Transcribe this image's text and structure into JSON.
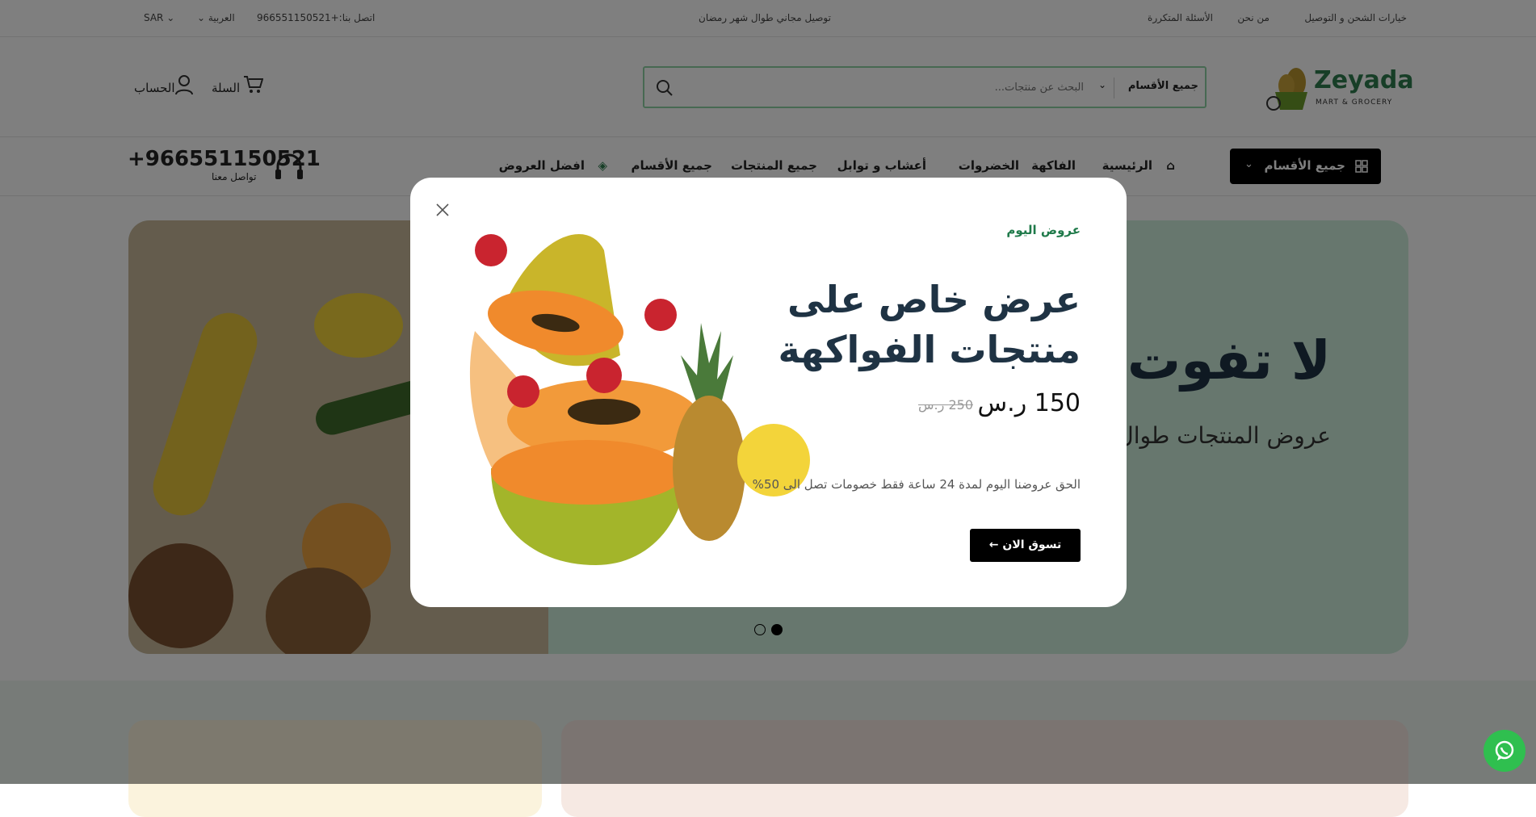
{
  "topbar": {
    "links": [
      "خيارات الشحن و التوصيل",
      "من نحن",
      "الأسئلة المتكررة"
    ],
    "promo": "توصيل مجاني طوال شهر رمضان",
    "contact": "اتصل بنا:+966551150521",
    "language": "العربية",
    "currency": "SAR"
  },
  "header": {
    "logo_name": "Zeyada",
    "logo_sub": "MART & GROCERY",
    "search_category": "جميع الأقسام",
    "search_placeholder": "البحث عن منتجات...",
    "cart_label": "السلة",
    "account_label": "الحساب"
  },
  "nav": {
    "categories_button": "جميع الأقسام",
    "items": [
      "الرئيسية",
      "الفاكهة",
      "الخضروات",
      "أعشاب و توابل",
      "جميع المنتجات",
      "جميع الأقسام",
      "افضل العروض"
    ],
    "phone": "+966551150521",
    "phone_label": "تواصل معنا"
  },
  "hero": {
    "title": "لا تفوت",
    "subtitle": "عروض المنتجات طوال",
    "slides": 2,
    "active_slide": 2
  },
  "modal": {
    "eyebrow": "عروض اليوم",
    "title": "عرض خاص على منتجات الفواكهة",
    "price": "150 ر.س",
    "old_price": "250 ر.س",
    "description": "الحق عروضنا اليوم لمدة 24 ساعة فقط خصومات تصل الى 50%",
    "cta": "تسوق الان ←"
  },
  "colors": {
    "brand_green": "#2e7d4f",
    "accent_green": "#1f7a4a",
    "dark": "#000000",
    "title": "#1f3344"
  }
}
